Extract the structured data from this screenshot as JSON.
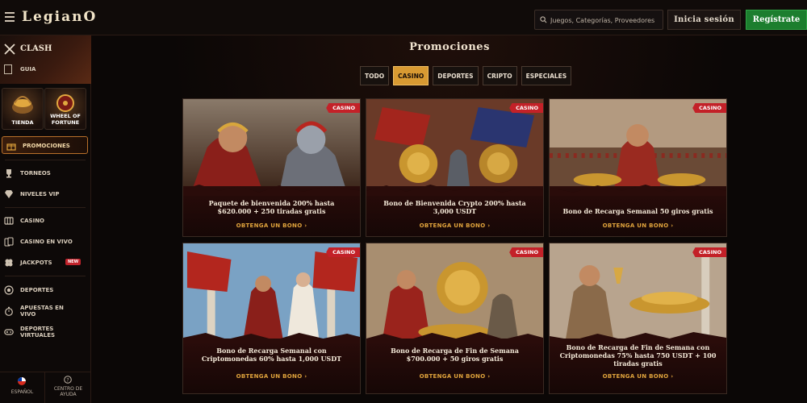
{
  "header": {
    "brand": "LegianO",
    "search_placeholder": "Juegos, Categorías, Proveedores",
    "login_label": "Inicia sesión",
    "register_label": "Regístrate"
  },
  "sidebar": {
    "clash_label": "CLASH",
    "guia_label": "GUIA",
    "tiles": [
      {
        "label": "TIENDA"
      },
      {
        "label": "WHEEL OF FORTUNE"
      }
    ],
    "items": [
      {
        "label": "PROMOCIONES"
      },
      {
        "label": "TORNEOS"
      },
      {
        "label": "NIVELES VIP"
      },
      {
        "label": "CASINO"
      },
      {
        "label": "CASINO EN VIVO"
      },
      {
        "label": "JACKPOTS",
        "badge": "NEW"
      },
      {
        "label": "DEPORTES"
      },
      {
        "label": "APUESTAS EN VIVO"
      },
      {
        "label": "DEPORTES VIRTUALES"
      }
    ],
    "footer": {
      "language": "ESPAÑOL",
      "help": "CENTRO DE AYUDA"
    }
  },
  "main": {
    "title": "Promociones",
    "filters": [
      {
        "label": "TODO",
        "active": false
      },
      {
        "label": "CASINO",
        "active": true
      },
      {
        "label": "DEPORTES",
        "active": false
      },
      {
        "label": "CRIPTO",
        "active": false
      },
      {
        "label": "ESPECIALES",
        "active": false
      }
    ],
    "cards": [
      {
        "tag": "CASINO",
        "title": "Paquete de bienvenida 200% hasta $620.000 + 250 tiradas gratis",
        "cta": "OBTENGA UN BONO  ›"
      },
      {
        "tag": "CASINO",
        "title": "Bono de Bienvenida Crypto 200% hasta 3,000 USDT",
        "cta": "OBTENGA UN BONO  ›"
      },
      {
        "tag": "CASINO",
        "title": "Bono de Recarga Semanal 50 giros gratis",
        "cta": "OBTENGA UN BONO  ›"
      },
      {
        "tag": "CASINO",
        "title": "Bono de Recarga Semanal con Criptomonedas 60% hasta 1,000 USDT",
        "cta": "OBTENGA UN BONO  ›"
      },
      {
        "tag": "CASINO",
        "title": "Bono de Recarga de Fin de Semana $700.000 + 50 giros gratis",
        "cta": "OBTENGA UN BONO  ›"
      },
      {
        "tag": "CASINO",
        "title": "Bono de Recarga de Fin de Semana con Criptomonedas 75% hasta 750 USDT + 100 tiradas gratis",
        "cta": "OBTENGA UN BONO  ›"
      }
    ]
  },
  "colors": {
    "accent_gold": "#d89a32",
    "register_green": "#1c7e2e",
    "ribbon_red": "#c32128"
  }
}
